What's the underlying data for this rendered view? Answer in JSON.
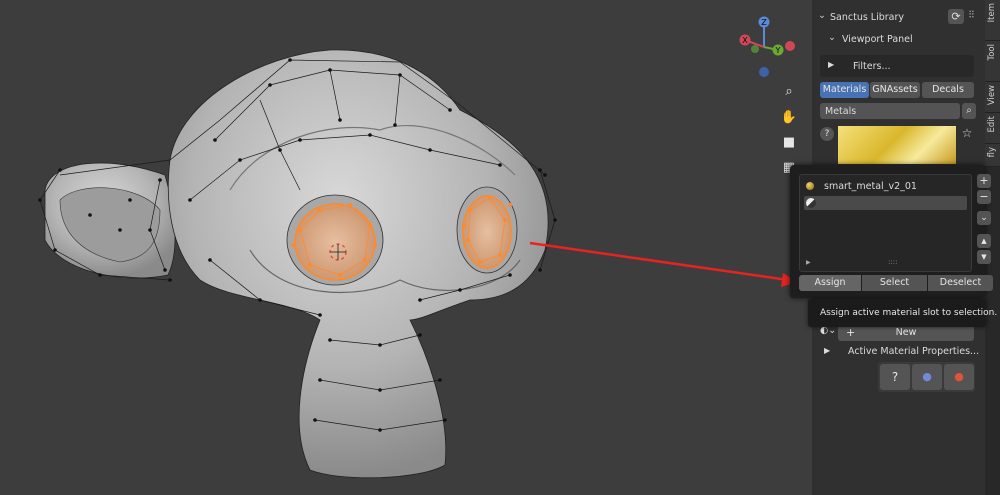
{
  "library": {
    "title": "Sanctus Library",
    "subpanel": "Viewport Panel",
    "filters_label": "Filters...",
    "tabs": [
      {
        "label": "Materials",
        "selected": true
      },
      {
        "label": "GNAssets",
        "selected": false
      },
      {
        "label": "Decals",
        "selected": false
      }
    ],
    "category": "Metals"
  },
  "side_tabs": [
    "Item",
    "Tool",
    "View",
    "Edit",
    "fly"
  ],
  "material_slots": {
    "items": [
      {
        "name": "smart_metal_v2_01"
      },
      {
        "name": ""
      }
    ],
    "assign_label": "Assign",
    "select_label": "Select",
    "deselect_label": "Deselect"
  },
  "tooltip": "Assign active material slot to selection.",
  "material": {
    "new_label": "New",
    "active_props_label": "Active Material Properties..."
  },
  "gizmo": {
    "z": "Z",
    "y": "Y",
    "x": "X"
  },
  "colors": {
    "accent": "#4772b3",
    "arrow": "#e52421",
    "selection": "#ff8a2a"
  }
}
